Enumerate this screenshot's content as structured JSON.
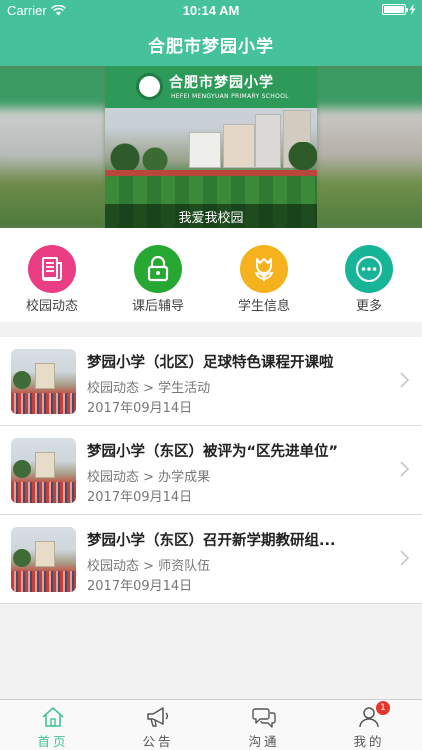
{
  "status_bar": {
    "carrier": "Carrier",
    "time": "10:14 AM"
  },
  "header": {
    "title": "合肥市梦园小学"
  },
  "banner": {
    "school_name": "合肥市梦园小学",
    "school_name_en": "HEFEI MENGYUAN PRIMARY SCHOOL",
    "caption": "我爱我校园"
  },
  "menu": [
    {
      "label": "校园动态",
      "icon": "newspaper-icon",
      "color": "#ea3d83"
    },
    {
      "label": "课后辅导",
      "icon": "lock-icon",
      "color": "#27a832"
    },
    {
      "label": "学生信息",
      "icon": "tulip-icon",
      "color": "#f6b21c"
    },
    {
      "label": "更多",
      "icon": "more-icon",
      "color": "#17b497"
    }
  ],
  "news": [
    {
      "title": "梦园小学（北区）足球特色课程开课啦",
      "category": "校园动态 > 学生活动",
      "date": "2017年09月14日"
    },
    {
      "title": "梦园小学（东区）被评为“区先进单位”",
      "category": "校园动态 > 办学成果",
      "date": "2017年09月14日"
    },
    {
      "title": "梦园小学（东区）召开新学期教研组...",
      "category": "校园动态 > 师资队伍",
      "date": "2017年09月14日"
    }
  ],
  "tabbar": [
    {
      "label": "首页",
      "icon": "home-icon",
      "active": true
    },
    {
      "label": "公告",
      "icon": "megaphone-icon",
      "active": false
    },
    {
      "label": "沟通",
      "icon": "chat-icon",
      "active": false
    },
    {
      "label": "我的",
      "icon": "person-icon",
      "active": false,
      "badge": "1"
    }
  ],
  "colors": {
    "accent": "#45c29a",
    "badge": "#e8352b"
  }
}
